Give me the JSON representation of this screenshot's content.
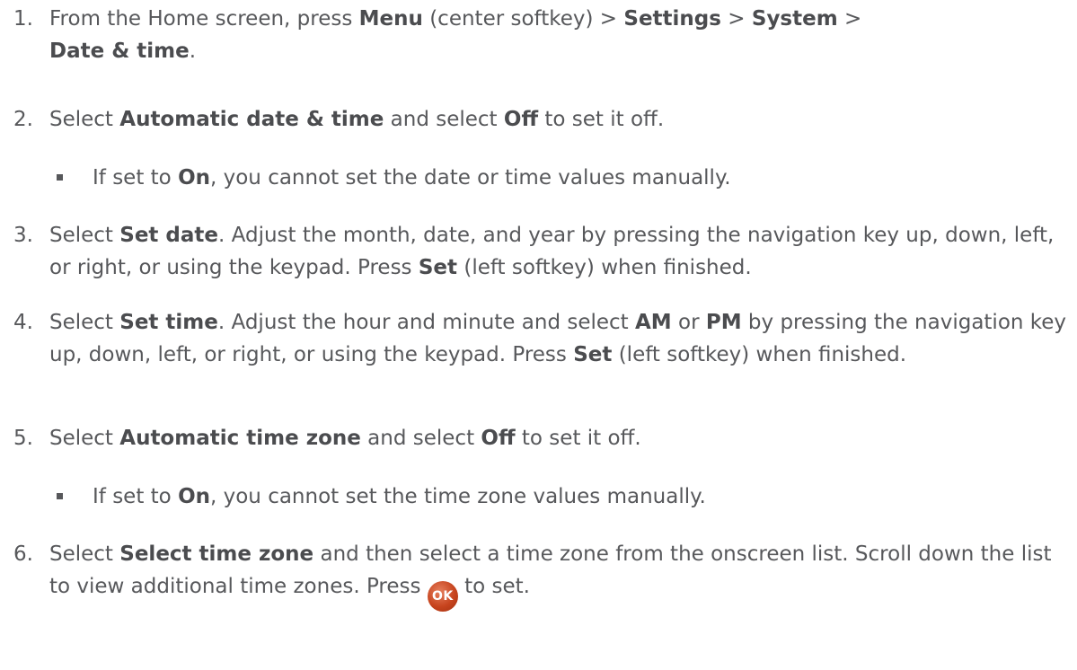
{
  "steps": [
    {
      "num": "1.",
      "p1": "From the Home screen, press ",
      "b1": "Menu",
      "p2": " (center softkey) > ",
      "b2": "Settings",
      "p3": " > ",
      "b3": "System",
      "p4": " > ",
      "b4": "Date & time",
      "p5": "."
    },
    {
      "num": "2.",
      "p1": "Select ",
      "b1": "Automatic date & time",
      "p2": " and select ",
      "b2": "Off",
      "p3": " to set it off."
    },
    {
      "num": "3.",
      "p1": "Select ",
      "b1": "Set date",
      "p2": ". Adjust the month, date, and year by pressing the navigation key up, down, left, or right, or using the keypad. Press ",
      "b2": "Set",
      "p3": " (left softkey) when finished."
    },
    {
      "num": "4.",
      "p1": "Select ",
      "b1": "Set time",
      "p2": ". Adjust the hour and minute and select ",
      "b2": "AM",
      "p3": " or ",
      "b3": "PM",
      "p4": " by pressing the navigation key up, down, left, or right, or using the keypad. Press ",
      "b4": "Set",
      "p5": " (left softkey) when finished."
    },
    {
      "num": "5.",
      "p1": "Select ",
      "b1": "Automatic time zone",
      "p2": " and select ",
      "b2": "Off",
      "p3": " to set it off."
    },
    {
      "num": "6.",
      "p1": "Select ",
      "b1": "Select time zone",
      "p2": " and then select a time zone from the onscreen list. Scroll down the list to view additional time zones. Press ",
      "icon_label": "OK",
      "p3": " to set."
    }
  ],
  "notes": [
    {
      "p1": "If set to ",
      "b1": "On",
      "p2": ", you cannot set the date or time values manually."
    },
    {
      "p1": "If set to ",
      "b1": "On",
      "p2": ", you cannot set the time zone values manually."
    }
  ],
  "icons": {
    "ok": "ok-button-icon"
  },
  "colors": {
    "text": "#57585b",
    "ok_icon": "#c7441e"
  }
}
